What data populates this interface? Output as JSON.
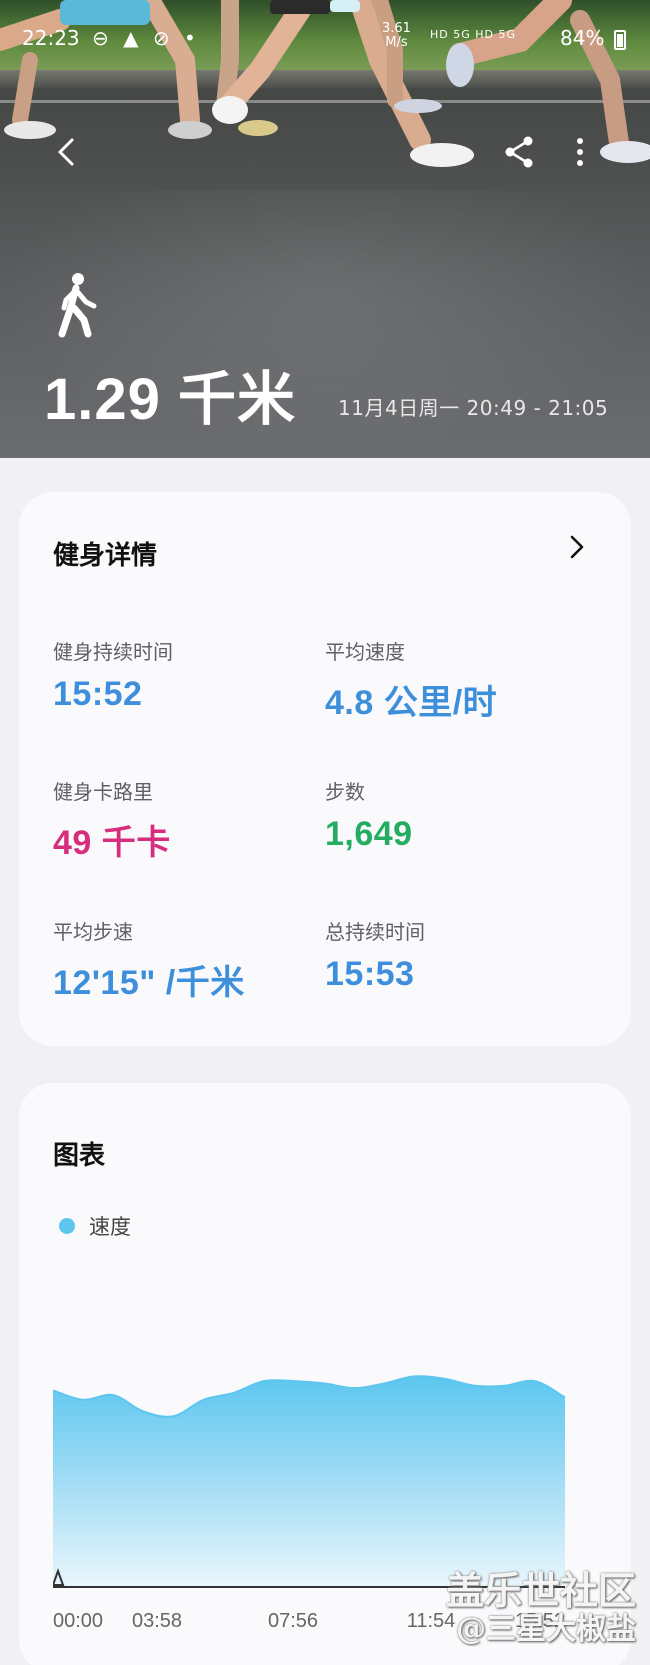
{
  "status_bar": {
    "time": "22:23",
    "left_icons": "⊖ ▲ ⊘ •",
    "net_speed": "3.61\nM/s",
    "network": "HD 5G HD 5G",
    "battery": "84%"
  },
  "hero": {
    "back_icon": "chevron-left-icon",
    "share_icon": "share-icon",
    "more_icon": "more-vertical-icon",
    "activity_icon": "walking-person-icon",
    "distance": "1.29 千米",
    "date_range": "11月4日周一 20:49 - 21:05"
  },
  "details": {
    "title": "健身详情",
    "metrics": [
      {
        "label": "健身持续时间",
        "value": "15:52",
        "color": "#3d8fdb"
      },
      {
        "label": "平均速度",
        "value": "4.8 公里/时",
        "color": "#3d8fdb"
      },
      {
        "label": "健身卡路里",
        "value": "49 千卡",
        "color": "#d62e7d"
      },
      {
        "label": "步数",
        "value": "1,649",
        "color": "#22ad61"
      },
      {
        "label": "平均步速",
        "value": "12'15\" /千米",
        "color": "#3d8fdb"
      },
      {
        "label": "总持续时间",
        "value": "15:53",
        "color": "#3d8fdb"
      }
    ]
  },
  "chart_card": {
    "title": "图表",
    "legend": "速度"
  },
  "chart_data": {
    "type": "area",
    "series": [
      {
        "name": "速度",
        "color": "#5cc6ef",
        "x": [
          "00:00",
          "00:55",
          "01:50",
          "02:45",
          "03:40",
          "04:20",
          "05:20",
          "06:15",
          "07:10",
          "08:05",
          "09:00",
          "09:55",
          "10:50",
          "11:45",
          "12:40",
          "13:35",
          "14:30",
          "15:20"
        ],
        "values": [
          0.84,
          0.8,
          0.82,
          0.75,
          0.73,
          0.8,
          0.83,
          0.88,
          0.88,
          0.87,
          0.85,
          0.87,
          0.9,
          0.89,
          0.86,
          0.86,
          0.88,
          0.81
        ]
      }
    ],
    "x_ticks": [
      "00:00",
      "03:58",
      "07:56",
      "11:54",
      "15:52"
    ],
    "ylim": [
      0,
      1
    ],
    "grid": false
  },
  "watermark": {
    "line1": "盖乐世社区",
    "line2": "@三星大椒盐"
  }
}
